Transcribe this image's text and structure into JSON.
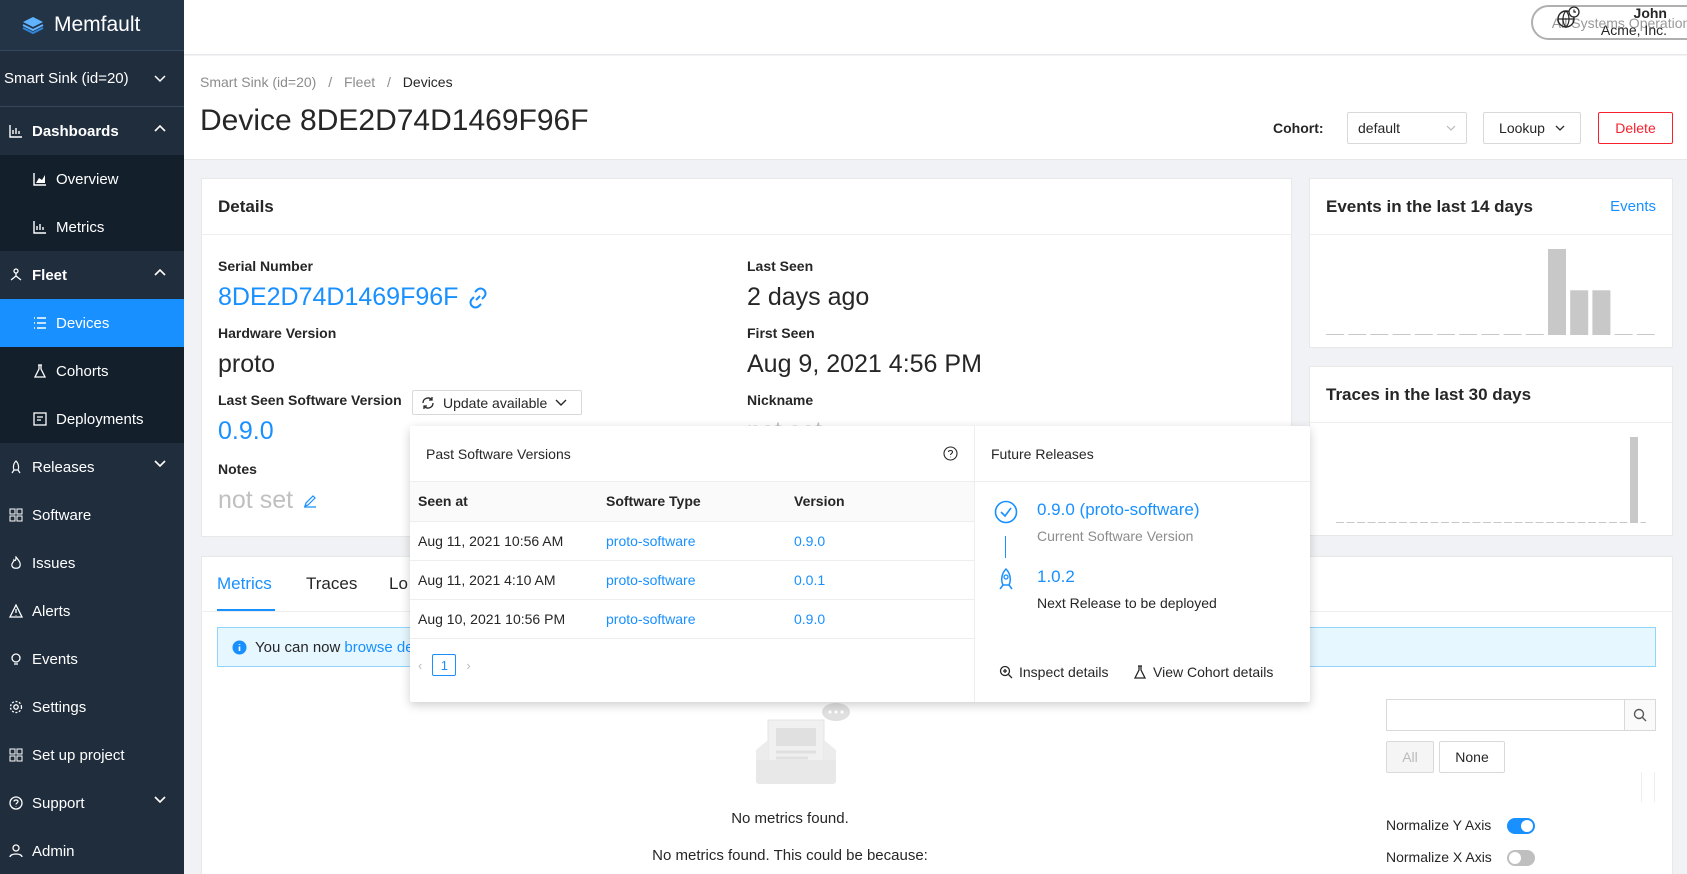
{
  "app": {
    "name": "Memfault"
  },
  "sidebar": {
    "project": "Smart Sink (id=20)",
    "items": [
      {
        "label": "Dashboards"
      },
      {
        "label": "Overview"
      },
      {
        "label": "Metrics"
      },
      {
        "label": "Fleet"
      },
      {
        "label": "Devices"
      },
      {
        "label": "Cohorts"
      },
      {
        "label": "Deployments"
      },
      {
        "label": "Releases"
      },
      {
        "label": "Software"
      },
      {
        "label": "Issues"
      },
      {
        "label": "Alerts"
      },
      {
        "label": "Events"
      },
      {
        "label": "Settings"
      },
      {
        "label": "Set up project"
      },
      {
        "label": "Support"
      },
      {
        "label": "Admin"
      }
    ]
  },
  "topbar": {
    "status": "All Systems Operational",
    "user_name": "John",
    "user_org": "Acme, Inc."
  },
  "header": {
    "breadcrumb": [
      "Smart Sink (id=20)",
      "/",
      "Fleet",
      "/",
      "Devices"
    ],
    "title": "Device 8DE2D74D1469F96F",
    "cohort_label": "Cohort:",
    "cohort_value": "default",
    "lookup_label": "Lookup",
    "delete_label": "Delete"
  },
  "details": {
    "title": "Details",
    "serial_label": "Serial Number",
    "serial_value": "8DE2D74D1469F96F",
    "hardware_label": "Hardware Version",
    "hardware_value": "proto",
    "software_label": "Last Seen Software Version",
    "update_label": "Update available",
    "software_value": "0.9.0",
    "notes_label": "Notes",
    "notes_value": "not set",
    "last_seen_label": "Last Seen",
    "last_seen_value": "2 days ago",
    "first_seen_label": "First Seen",
    "first_seen_value": "Aug 9, 2021 4:56 PM",
    "nickname_label": "Nickname",
    "nickname_value": "not set"
  },
  "events_card": {
    "title": "Events in the last 14 days",
    "link": "Events",
    "bar_values": [
      0,
      0,
      0,
      0,
      0,
      0,
      0,
      0,
      0,
      0,
      1.0,
      0.52,
      0.52,
      0,
      0
    ]
  },
  "traces_card": {
    "title": "Traces in the last 30 days",
    "bar_values": [
      0,
      0,
      0,
      0,
      0,
      0,
      0,
      0,
      0,
      0,
      0,
      0,
      0,
      0,
      0,
      0,
      0,
      0,
      0,
      0,
      0,
      0,
      0,
      0,
      0,
      0,
      0,
      0,
      1.0,
      0
    ]
  },
  "popover": {
    "past_title": "Past Software Versions",
    "columns": [
      "Seen at",
      "Software Type",
      "Version"
    ],
    "rows": [
      {
        "seen": "Aug 11, 2021 10:56 AM",
        "type": "proto-software",
        "version": "0.9.0"
      },
      {
        "seen": "Aug 11, 2021 4:10 AM",
        "type": "proto-software",
        "version": "0.0.1"
      },
      {
        "seen": "Aug 10, 2021 10:56 PM",
        "type": "proto-software",
        "version": "0.9.0"
      }
    ],
    "page": "1",
    "future_title": "Future Releases",
    "current_release": "0.9.0 (proto-software)",
    "current_sub": "Current Software Version",
    "next_release": "1.0.2",
    "next_sub": "Next Release to be deployed",
    "inspect_label": "Inspect details",
    "cohort_details_label": "View Cohort details"
  },
  "tabs": {
    "metrics": "Metrics",
    "traces": "Traces",
    "logs": "Lo"
  },
  "info": {
    "prefix": "You can now",
    "link": "browse de"
  },
  "metrics_panel": {
    "filter_all": "All",
    "filter_none": "None",
    "empty_title": "No metrics found.",
    "empty_sub": "No metrics found. This could be because:",
    "normalize_y": "Normalize Y Axis",
    "normalize_y_on": true,
    "normalize_x": "Normalize X Axis",
    "normalize_x_on": false
  },
  "colors": {
    "accent": "#1890ff",
    "sidebar": "#1f2d3d",
    "danger": "#f5222d"
  }
}
